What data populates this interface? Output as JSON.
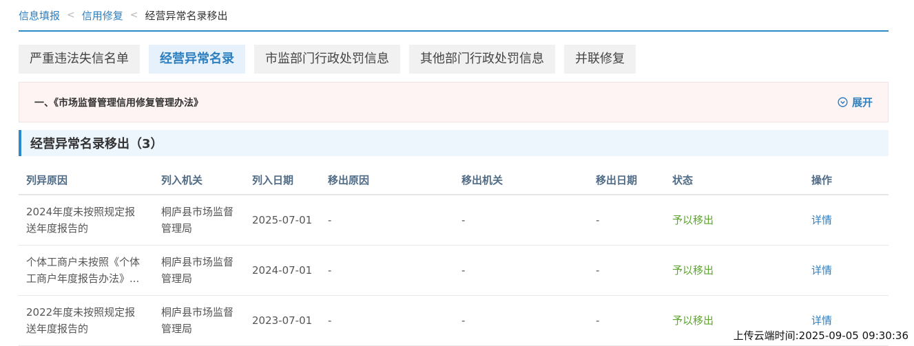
{
  "breadcrumb": {
    "items": [
      "信息填报",
      "信用修复"
    ],
    "current": "经营异常名录移出"
  },
  "tabs": [
    {
      "label": "严重违法失信名单",
      "active": false
    },
    {
      "label": "经营异常名录",
      "active": true
    },
    {
      "label": "市监部门行政处罚信息",
      "active": false
    },
    {
      "label": "其他部门行政处罚信息",
      "active": false
    },
    {
      "label": "并联修复",
      "active": false
    }
  ],
  "policy": {
    "title": "一、《市场监督管理信用修复管理办法》",
    "expand_label": "展开"
  },
  "section": {
    "title": "经营异常名录移出（3）"
  },
  "table": {
    "headers": [
      "列异原因",
      "列入机关",
      "列入日期",
      "移出原因",
      "移出机关",
      "移出日期",
      "状态",
      "操作"
    ],
    "rows": [
      {
        "reason_line1": "2024年度未按照规定报",
        "reason_line2": "送年度报告的",
        "org_line1": "桐庐县市场监督",
        "org_line2": "管理局",
        "date": "2025-07-01",
        "out_reason": "-",
        "out_org": "-",
        "out_date": "-",
        "status": "予以移出",
        "action": "详情"
      },
      {
        "reason_line1": "个体工商户未按照《个体",
        "reason_line2": "工商户年度报告办法》...",
        "org_line1": "桐庐县市场监督",
        "org_line2": "管理局",
        "date": "2024-07-01",
        "out_reason": "-",
        "out_org": "-",
        "out_date": "-",
        "status": "予以移出",
        "action": "详情"
      },
      {
        "reason_line1": "2022年度未按照规定报",
        "reason_line2": "送年度报告的",
        "org_line1": "桐庐县市场监督",
        "org_line2": "管理局",
        "date": "2023-07-01",
        "out_reason": "-",
        "out_org": "-",
        "out_date": "-",
        "status": "予以移出",
        "action": "详情"
      }
    ]
  },
  "timestamp": "上传云端时间:2025-09-05 09:30:36",
  "colors": {
    "accent": "#2d7fc0",
    "status_green": "#5aa52a"
  }
}
